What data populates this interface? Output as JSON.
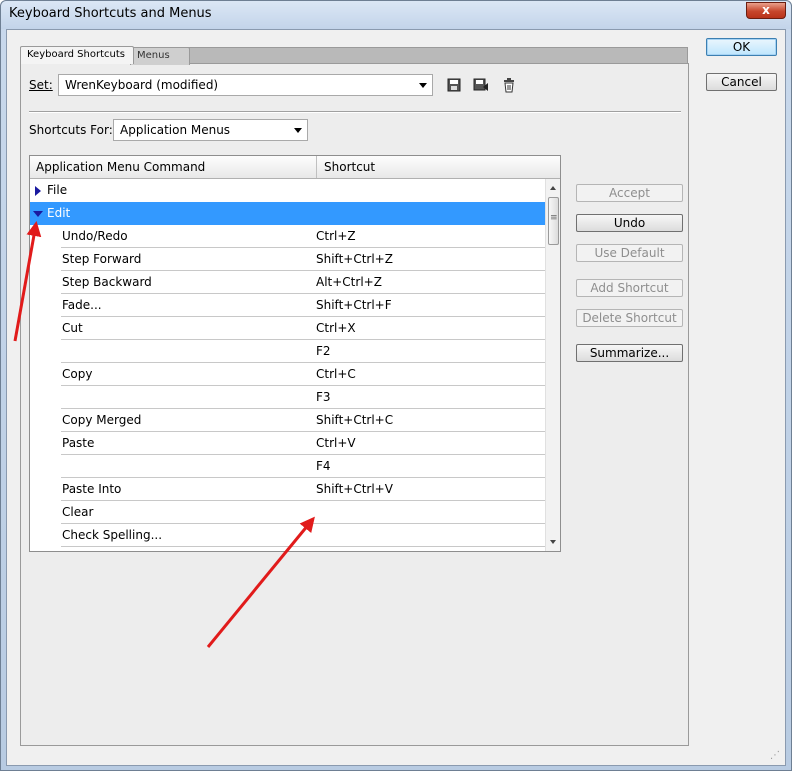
{
  "window": {
    "title": "Keyboard Shortcuts and Menus",
    "close_label": "x"
  },
  "tabs": [
    {
      "label": "Keyboard Shortcuts",
      "active": true
    },
    {
      "label": "Menus",
      "active": false
    }
  ],
  "set": {
    "label": "Set:",
    "value": "WrenKeyboard (modified)"
  },
  "toolbar_icons": [
    "save-set-icon",
    "save-set-as-icon",
    "delete-set-icon"
  ],
  "shortcuts_for": {
    "label": "Shortcuts For:",
    "value": "Application Menus"
  },
  "table": {
    "columns": [
      "Application Menu Command",
      "Shortcut"
    ],
    "rows": [
      {
        "command": "File",
        "shortcut": "",
        "type": "group",
        "expanded": false
      },
      {
        "command": "Edit",
        "shortcut": "",
        "type": "group",
        "expanded": true,
        "selected": true
      },
      {
        "command": "Undo/Redo",
        "shortcut": "Ctrl+Z",
        "type": "item"
      },
      {
        "command": "Step Forward",
        "shortcut": "Shift+Ctrl+Z",
        "type": "item"
      },
      {
        "command": "Step Backward",
        "shortcut": "Alt+Ctrl+Z",
        "type": "item"
      },
      {
        "command": "Fade...",
        "shortcut": "Shift+Ctrl+F",
        "type": "item"
      },
      {
        "command": "Cut",
        "shortcut": "Ctrl+X",
        "type": "item"
      },
      {
        "command": "",
        "shortcut": "F2",
        "type": "item"
      },
      {
        "command": "Copy",
        "shortcut": "Ctrl+C",
        "type": "item"
      },
      {
        "command": "",
        "shortcut": "F3",
        "type": "item"
      },
      {
        "command": "Copy Merged",
        "shortcut": "Shift+Ctrl+C",
        "type": "item"
      },
      {
        "command": "Paste",
        "shortcut": "Ctrl+V",
        "type": "item"
      },
      {
        "command": "",
        "shortcut": "F4",
        "type": "item"
      },
      {
        "command": "Paste Into",
        "shortcut": "Shift+Ctrl+V",
        "type": "item"
      },
      {
        "command": "Clear",
        "shortcut": "",
        "type": "item"
      },
      {
        "command": "Check Spelling...",
        "shortcut": "",
        "type": "item"
      }
    ]
  },
  "side_buttons": {
    "accept": {
      "label": "Accept",
      "enabled": false
    },
    "undo": {
      "label": "Undo",
      "enabled": true
    },
    "use_default": {
      "label": "Use Default",
      "enabled": false
    },
    "add_shortcut": {
      "label": "Add Shortcut",
      "enabled": false
    },
    "delete_shortcut": {
      "label": "Delete Shortcut",
      "enabled": false
    },
    "summarize": {
      "label": "Summarize...",
      "enabled": true
    }
  },
  "dialog_buttons": {
    "ok": "OK",
    "cancel": "Cancel"
  },
  "colors": {
    "selection": "#3399ff",
    "annotation_arrow": "#e11b1b",
    "triangle": "#1a1aa0"
  }
}
